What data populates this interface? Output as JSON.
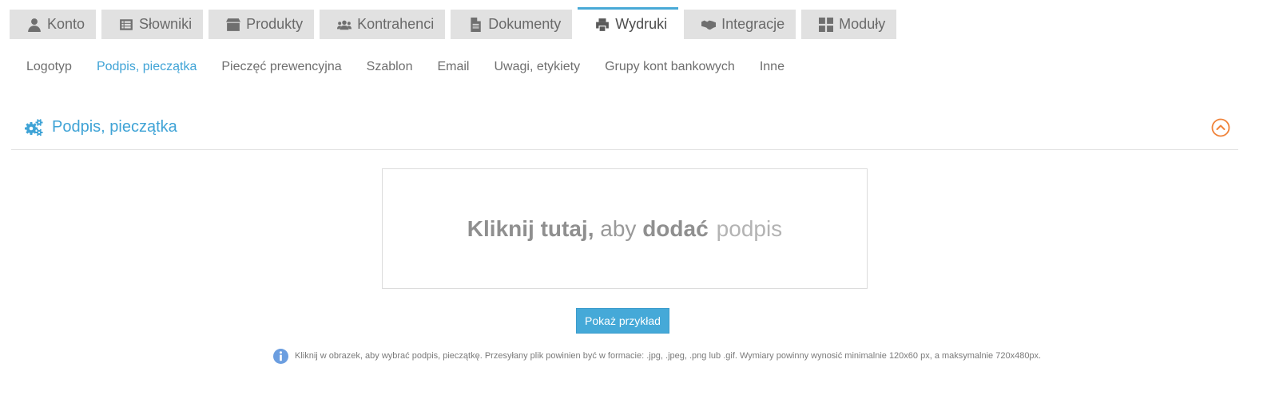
{
  "tabs": [
    {
      "label": "Konto",
      "icon": "user-icon"
    },
    {
      "label": "Słowniki",
      "icon": "list-icon"
    },
    {
      "label": "Produkty",
      "icon": "box-icon"
    },
    {
      "label": "Kontrahenci",
      "icon": "users-icon"
    },
    {
      "label": "Dokumenty",
      "icon": "document-icon"
    },
    {
      "label": "Wydruki",
      "icon": "printer-icon",
      "active": true
    },
    {
      "label": "Integracje",
      "icon": "handshake-icon"
    },
    {
      "label": "Moduły",
      "icon": "grid-icon"
    }
  ],
  "subnav": [
    {
      "label": "Logotyp"
    },
    {
      "label": "Podpis, pieczątka",
      "active": true
    },
    {
      "label": "Pieczęć prewencyjna"
    },
    {
      "label": "Szablon"
    },
    {
      "label": "Email"
    },
    {
      "label": "Uwagi, etykiety"
    },
    {
      "label": "Grupy kont bankowych"
    },
    {
      "label": "Inne"
    }
  ],
  "section": {
    "title": "Podpis, pieczątka"
  },
  "upload": {
    "bold1": "Kliknij tutaj,",
    "normal": "aby",
    "bold2": "dodać",
    "light": "podpis"
  },
  "button": {
    "label": "Pokaż przykład"
  },
  "info": {
    "text": "Kliknij w obrazek, aby wybrać podpis, pieczątkę. Przesyłany plik powinien być w formacie: .jpg, .jpeg, .png lub .gif. Wymiary powinny wynosić minimalnie 120x60 px, a maksymalnie 720x480px."
  },
  "colors": {
    "accent": "#3fa3d6",
    "button": "#45a9d8",
    "tab_bg": "#e1e1e1",
    "collapse": "#f0833a",
    "info_icon": "#6b9ee0"
  }
}
